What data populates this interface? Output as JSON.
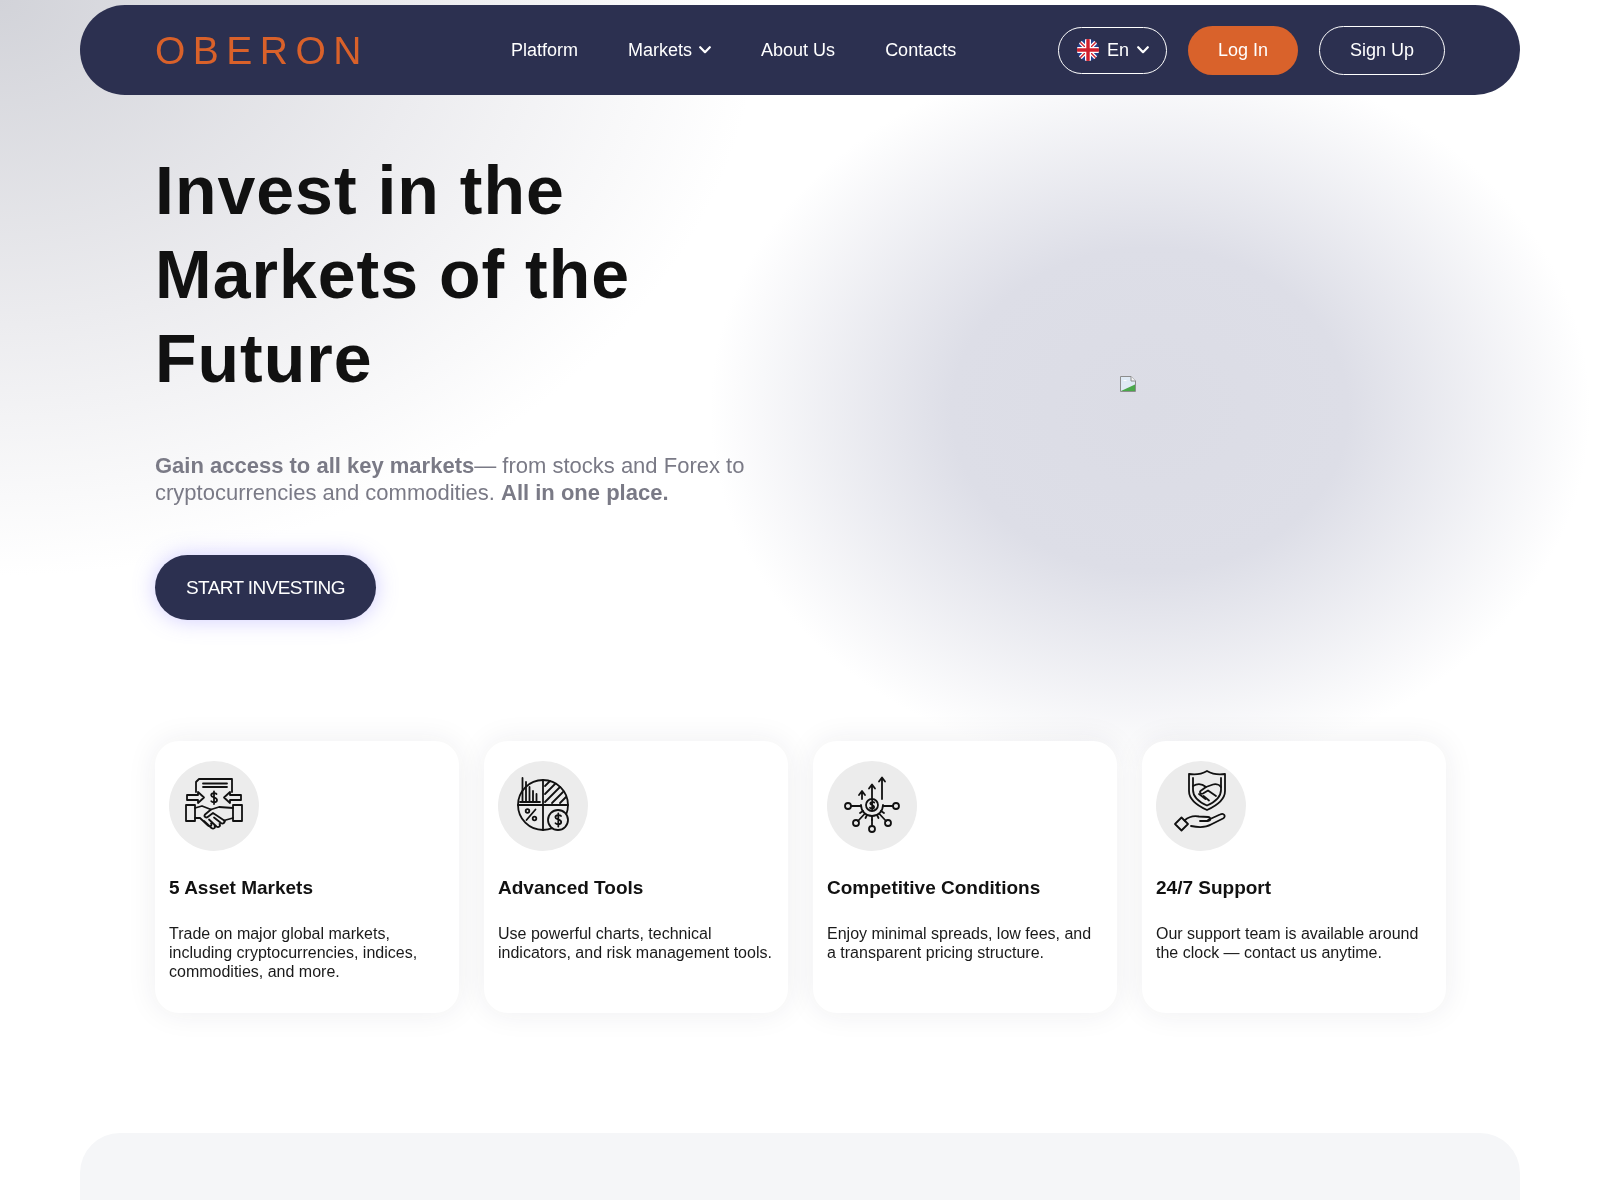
{
  "header": {
    "logo": "OBERON",
    "nav": [
      {
        "label": "Platform",
        "dropdown": false
      },
      {
        "label": "Markets",
        "dropdown": true
      },
      {
        "label": "About Us",
        "dropdown": false
      },
      {
        "label": "Contacts",
        "dropdown": false
      }
    ],
    "language": {
      "label": "En"
    },
    "buttons": [
      {
        "label": "Log In",
        "kind": "primary"
      },
      {
        "label": "Sign Up",
        "kind": "outline"
      }
    ]
  },
  "hero": {
    "title": "Invest in the Markets of the Future",
    "subtitle": "**Gain access to all key markets**— from stocks and Forex to cryptocurrencies and commodities. **All in one place.**",
    "cta": "START INVESTING"
  },
  "features": [
    {
      "title": "5 Asset Markets",
      "text": "Trade on major global markets, including cryptocurrencies, indices, commodities, and more."
    },
    {
      "title": "Advanced Tools",
      "text": "Use powerful charts, technical indicators, and risk management tools."
    },
    {
      "title": "Competitive Conditions",
      "text": "Enjoy minimal spreads, low fees, and a transparent pricing structure."
    },
    {
      "title": "24/7 Support",
      "text": "Our support team is available around the clock — contact us anytime."
    }
  ]
}
